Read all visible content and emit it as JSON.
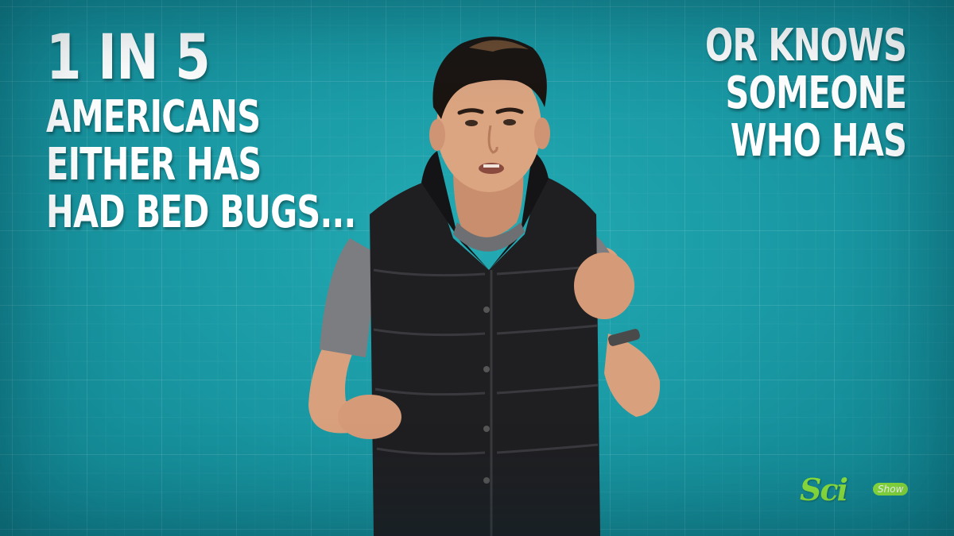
{
  "left_caption": {
    "line1": "1 IN 5",
    "line2": "AMERICANS",
    "line3": "EITHER HAS",
    "line4": "HAD BED BUGS..."
  },
  "right_caption": {
    "line1": "OR KNOWS",
    "line2": "SOMEONE",
    "line3": "WHO HAS"
  },
  "logo": {
    "main": "Sci",
    "sub": "Show"
  },
  "colors": {
    "background": "#1a9aa5",
    "text": "#ffffff",
    "logo_green": "#8de23c"
  }
}
